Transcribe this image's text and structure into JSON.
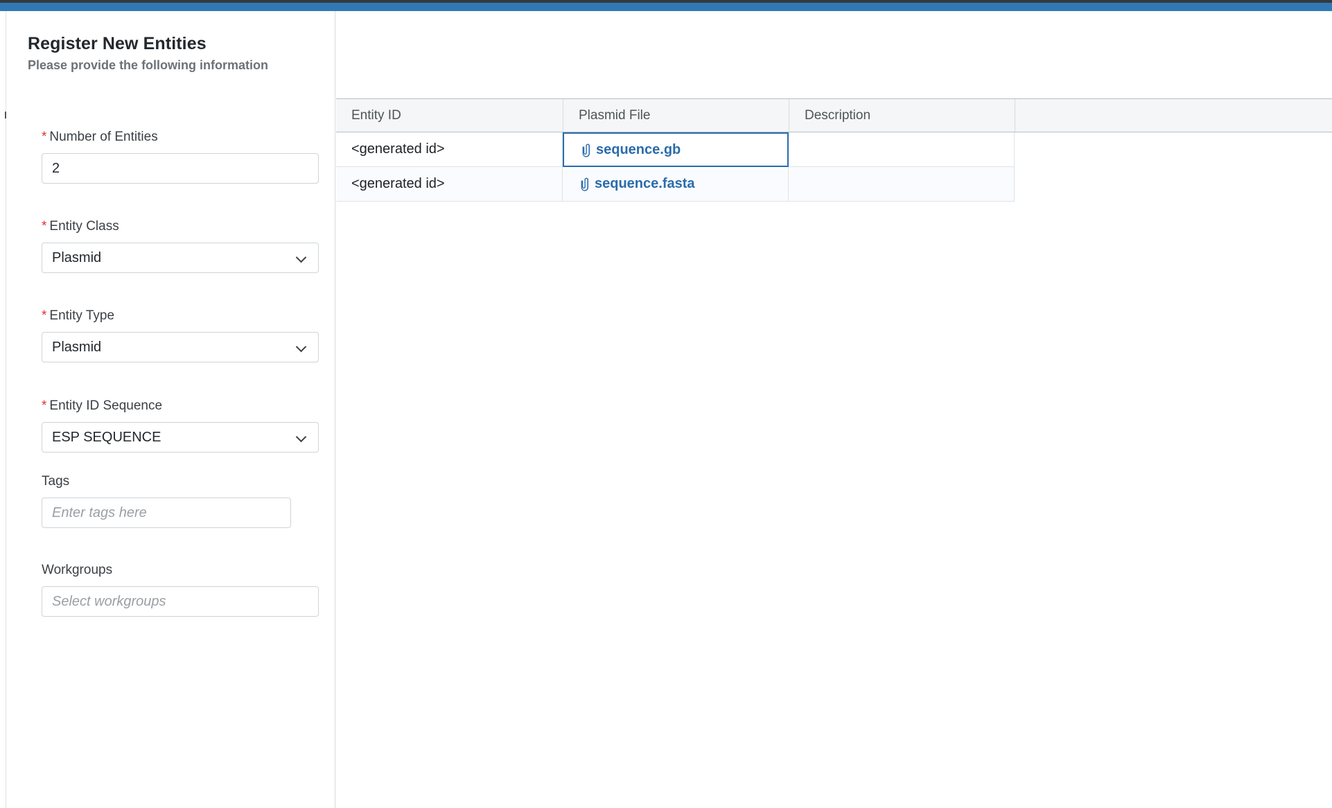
{
  "chrome": {
    "accent_dark": "#333a40",
    "accent_blue": "#3179b5"
  },
  "header": {
    "title": "Register New Entities",
    "subtitle": "Please provide the following information"
  },
  "form": {
    "required_marker": "*",
    "fields": [
      {
        "name": "number-of-entities",
        "label": "Number of Entities",
        "required": true,
        "control": "text",
        "value": "2",
        "placeholder": ""
      },
      {
        "name": "entity-class",
        "label": "Entity Class",
        "required": true,
        "control": "select",
        "value": "Plasmid",
        "placeholder": ""
      },
      {
        "name": "entity-type",
        "label": "Entity Type",
        "required": true,
        "control": "select",
        "value": "Plasmid",
        "placeholder": ""
      },
      {
        "name": "entity-id-sequence",
        "label": "Entity ID Sequence",
        "required": true,
        "control": "select",
        "value": "ESP SEQUENCE",
        "placeholder": ""
      },
      {
        "name": "tags",
        "label": "Tags",
        "required": false,
        "control": "text",
        "value": "",
        "placeholder": "Enter tags here"
      },
      {
        "name": "workgroups",
        "label": "Workgroups",
        "required": false,
        "control": "text",
        "value": "",
        "placeholder": "Select workgroups"
      }
    ]
  },
  "grid": {
    "columns": [
      {
        "key": "entity_id",
        "label": "Entity ID"
      },
      {
        "key": "plasmid_file",
        "label": "Plasmid File"
      },
      {
        "key": "description",
        "label": "Description"
      }
    ],
    "rows": [
      {
        "entity_id": "<generated id>",
        "plasmid_file": "sequence.gb",
        "file_icon": "paperclip-icon",
        "description": "",
        "selected_cell": "plasmid_file"
      },
      {
        "entity_id": "<generated id>",
        "plasmid_file": "sequence.fasta",
        "file_icon": "paperclip-icon",
        "description": "",
        "selected_cell": ""
      }
    ],
    "selection_color": "#2b6cab",
    "link_color": "#2b6cab",
    "header_bg": "#f4f6f7",
    "row_stripe_bg": "#f9fbfe"
  }
}
